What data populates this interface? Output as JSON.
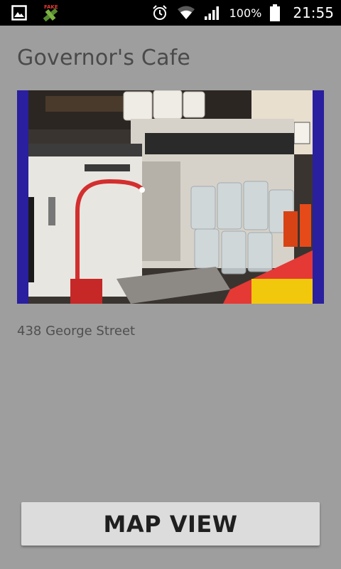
{
  "status_bar": {
    "left_icons": [
      "gallery-icon",
      "fake-gps-icon"
    ],
    "fake_gps_label": "FAKE",
    "right_icons": [
      "alarm-icon",
      "wifi-icon",
      "signal-icon",
      "battery-icon"
    ],
    "battery_percent": "100%",
    "time": "21:55"
  },
  "cafe": {
    "title": "Governor's Cafe",
    "address": "438 George Street"
  },
  "actions": {
    "map_view_label": "MAP VIEW"
  },
  "colors": {
    "background": "#9e9e9e",
    "status_bar": "#000000",
    "photo_border": "#2a1f9e",
    "button": "#dcdcdc",
    "title_text": "#4a4a4a"
  }
}
